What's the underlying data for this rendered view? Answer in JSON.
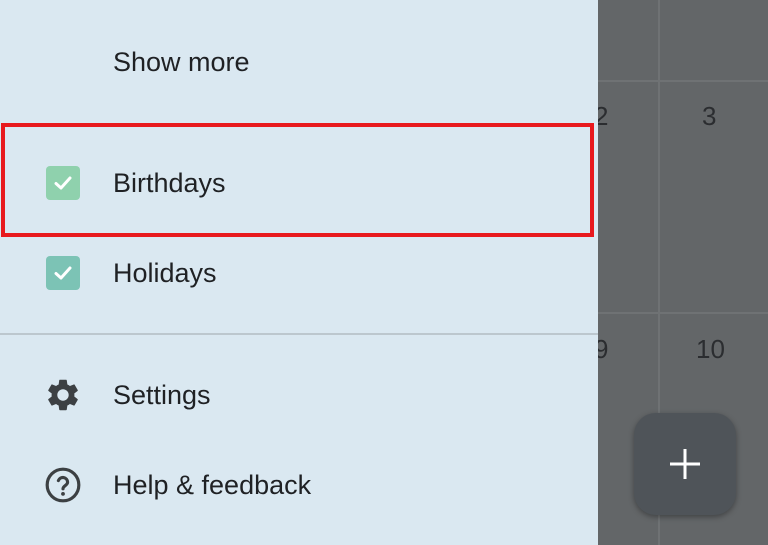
{
  "drawer": {
    "show_more": "Show more",
    "calendars": [
      {
        "label": "Birthdays",
        "checked": true,
        "color": "#8fd1ad"
      },
      {
        "label": "Holidays",
        "checked": true,
        "color": "#7cc3b5"
      }
    ],
    "settings_label": "Settings",
    "help_label": "Help & feedback"
  },
  "calendar": {
    "days": [
      "2",
      "3",
      "9",
      "10"
    ]
  },
  "fab": {
    "icon": "plus-icon"
  },
  "colors": {
    "drawer_bg": "#dae8f1",
    "highlight": "#e8191e",
    "overlay": "#636668"
  }
}
